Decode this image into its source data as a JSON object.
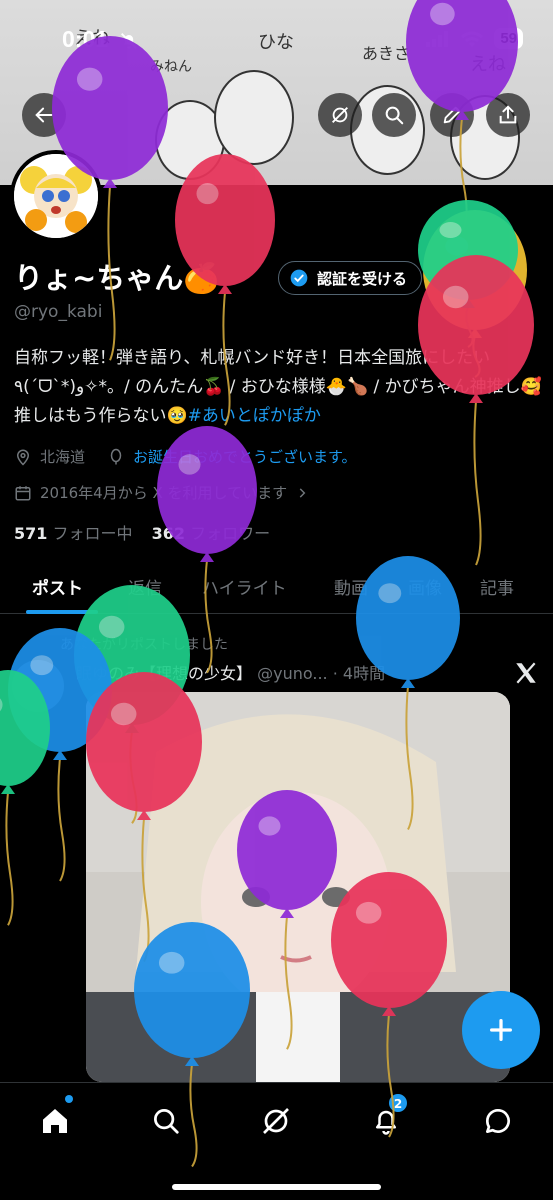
{
  "status": {
    "time": "0:01",
    "battery": "59"
  },
  "banner": {
    "scribbles": [
      "えね",
      "みねん",
      "ひな",
      "あきさ",
      "えね"
    ]
  },
  "header_buttons": [
    "back",
    "grok",
    "search",
    "edit",
    "share"
  ],
  "profile": {
    "name": "りょ~ちゃん",
    "name_emoji": "🍊",
    "verify_label": "認証を受ける",
    "handle": "@ryo_kabi",
    "bio_text": "自称フッ軽！弾き語り、札幌バンド好き！日本全国旅にしたい٩(ˊᗜˋ*)و✧*。/ のんたん🍒 / おひな様様🐣🍗 / かびちゃん神推し🥰 推しはもう作らない🥹",
    "bio_hashtag": "#あいとぽかぽか",
    "location": "北海道",
    "birthday": "お誕生日おめでとうございます。",
    "joined": "2016年4月から X を利用しています",
    "following_count": "571",
    "following_label": "フォロー中",
    "followers_count": "362",
    "followers_label": "フォロワー"
  },
  "tabs": [
    "ポスト",
    "返信",
    "ハイライト",
    "動画",
    "画像",
    "記事"
  ],
  "post": {
    "repost_line": "あなたがリポストしました",
    "author_name": "眠ゆのみ【理想の少女】",
    "author_meta": "@yuno... · 4時間"
  },
  "bottom_nav": {
    "notification_count": "2"
  },
  "colors": {
    "accent": "#1d9bf0",
    "background": "#000000",
    "text_primary": "#e7e9ea",
    "text_secondary": "#71767b"
  },
  "balloons": [
    {
      "color": "#8e2bd6"
    },
    {
      "color": "#8e2bd6"
    },
    {
      "color": "#e8345a"
    },
    {
      "color": "#f1c232"
    },
    {
      "color": "#1fcf8a"
    },
    {
      "color": "#e8345a"
    },
    {
      "color": "#8e2bd6"
    },
    {
      "color": "#1fcf8a"
    },
    {
      "color": "#1d8fe8"
    },
    {
      "color": "#1d8fe8"
    },
    {
      "color": "#1fcf8a"
    },
    {
      "color": "#e8345a"
    },
    {
      "color": "#8e2bd6"
    },
    {
      "color": "#e8345a"
    },
    {
      "color": "#1d8fe8"
    }
  ]
}
